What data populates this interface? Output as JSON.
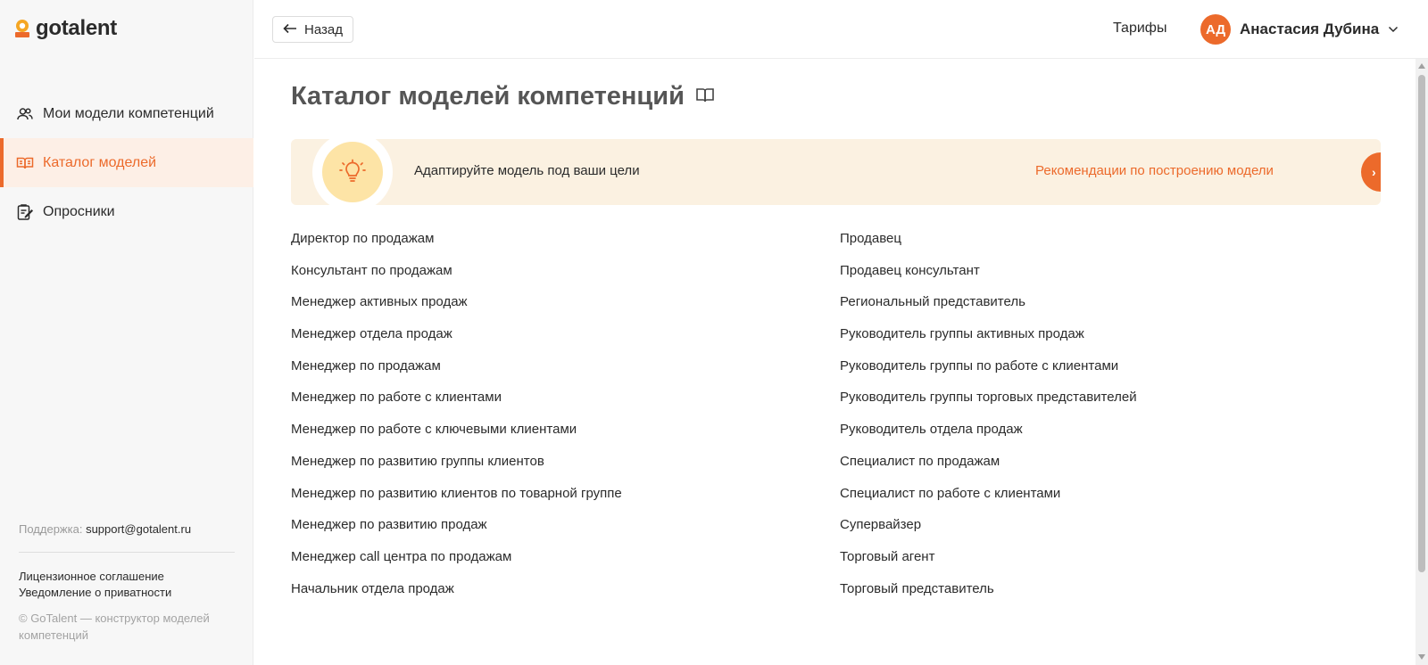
{
  "app": {
    "logo_text": "gotalent"
  },
  "sidebar": {
    "items": [
      {
        "label": "Мои модели компетенций",
        "icon": "users-icon",
        "active": false
      },
      {
        "label": "Каталог моделей",
        "icon": "open-book-icon",
        "active": true
      },
      {
        "label": "Опросники",
        "icon": "clipboard-edit-icon",
        "active": false
      }
    ],
    "support_label": "Поддержка:",
    "support_email": "support@gotalent.ru",
    "license_link": "Лицензионное соглашение",
    "privacy_link": "Уведомление о приватности",
    "copyright": "© GoTalent — конструктор моделей компетенций"
  },
  "header": {
    "back_label": "Назад",
    "tariffs_label": "Тарифы",
    "user_initials": "АД",
    "user_name": "Анастасия Дубина"
  },
  "main": {
    "title": "Каталог моделей компетенций",
    "banner": {
      "text": "Адаптируйте модель под ваши цели",
      "link": "Рекомендации по построению модели",
      "arrow": "›"
    },
    "models_left": [
      "Директор по продажам",
      "Консультант по продажам",
      "Менеджер активных продаж",
      "Менеджер отдела продаж",
      "Менеджер по продажам",
      "Менеджер по работе с клиентами",
      "Менеджер по работе с ключевыми клиентами",
      "Менеджер по развитию группы клиентов",
      "Менеджер по развитию клиентов по товарной группе",
      "Менеджер по развитию продаж",
      "Менеджер call центра по продажам",
      "Начальник отдела продаж"
    ],
    "models_right": [
      "Продавец",
      "Продавец консультант",
      "Региональный представитель",
      "Руководитель группы активных продаж",
      "Руководитель группы по работе с клиентами",
      "Руководитель группы торговых представителей",
      "Руководитель отдела продаж",
      "Специалист по продажам",
      "Специалист по работе с клиентами",
      "Супервайзер",
      "Торговый агент",
      "Торговый представитель"
    ]
  },
  "colors": {
    "accent": "#ec6a2b",
    "banner_bg": "#fbf1e1",
    "active_bg": "#fdefe6"
  }
}
